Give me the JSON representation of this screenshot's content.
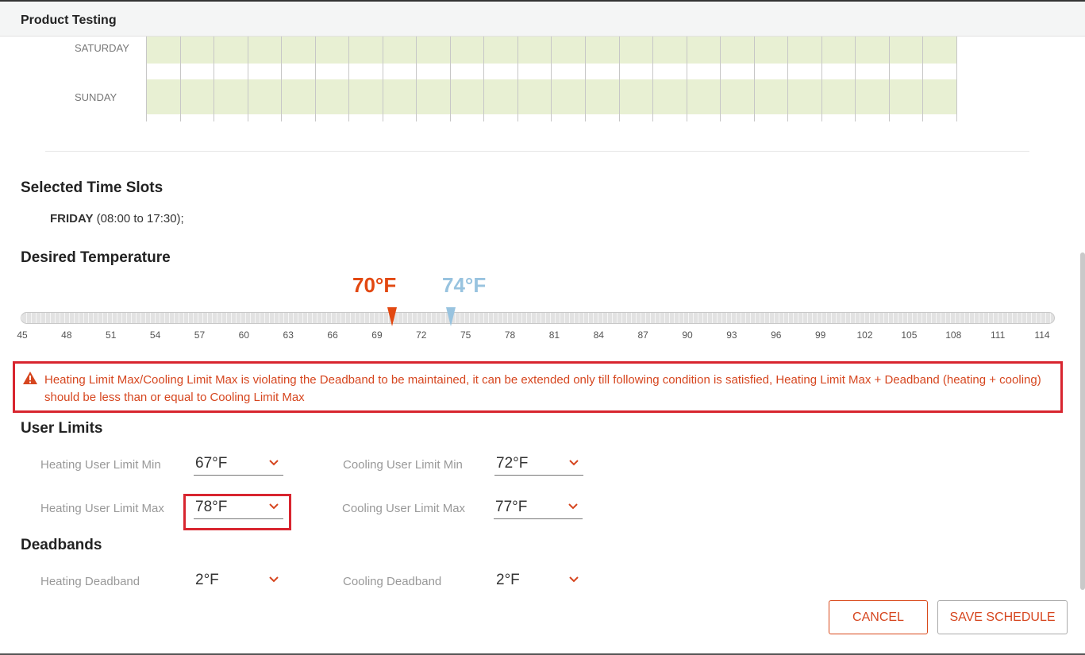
{
  "app": {
    "title": "Product Testing"
  },
  "schedule": {
    "days": [
      "SATURDAY",
      "SUNDAY"
    ]
  },
  "selected_time_slots": {
    "title": "Selected Time Slots",
    "day": "FRIDAY",
    "range": " (08:00 to 17:30);"
  },
  "desired_temperature": {
    "title": "Desired Temperature",
    "heating": "70°F",
    "cooling": "74°F",
    "heating_value": 70,
    "cooling_value": 74,
    "scale_min": 45,
    "scale_max": 114,
    "ticks": [
      "45",
      "48",
      "51",
      "54",
      "57",
      "60",
      "63",
      "66",
      "69",
      "72",
      "75",
      "78",
      "81",
      "84",
      "87",
      "90",
      "93",
      "96",
      "99",
      "102",
      "105",
      "108",
      "111",
      "114"
    ],
    "colors": {
      "heating": "#e24811",
      "cooling": "#98c3df"
    }
  },
  "alert": {
    "icon": "warning-icon",
    "message": "Heating Limit Max/Cooling Limit Max is violating the Deadband to be maintained, it can be extended only till following condition is satisfied, Heating Limit Max + Deadband (heating + cooling) should be less than or equal to Cooling Limit Max",
    "color": "#d8252f"
  },
  "user_limits": {
    "title": "User Limits",
    "heating_min": {
      "label": "Heating User Limit Min",
      "value": "67°F"
    },
    "cooling_min": {
      "label": "Cooling User Limit Min",
      "value": "72°F"
    },
    "heating_max": {
      "label": "Heating User Limit Max",
      "value": "78°F"
    },
    "cooling_max": {
      "label": "Cooling User Limit Max",
      "value": "77°F"
    }
  },
  "deadbands": {
    "title": "Deadbands",
    "heating": {
      "label": "Heating Deadband",
      "value": "2°F"
    },
    "cooling": {
      "label": "Cooling Deadband",
      "value": "2°F"
    }
  },
  "buttons": {
    "cancel": "CANCEL",
    "save": "SAVE SCHEDULE"
  }
}
